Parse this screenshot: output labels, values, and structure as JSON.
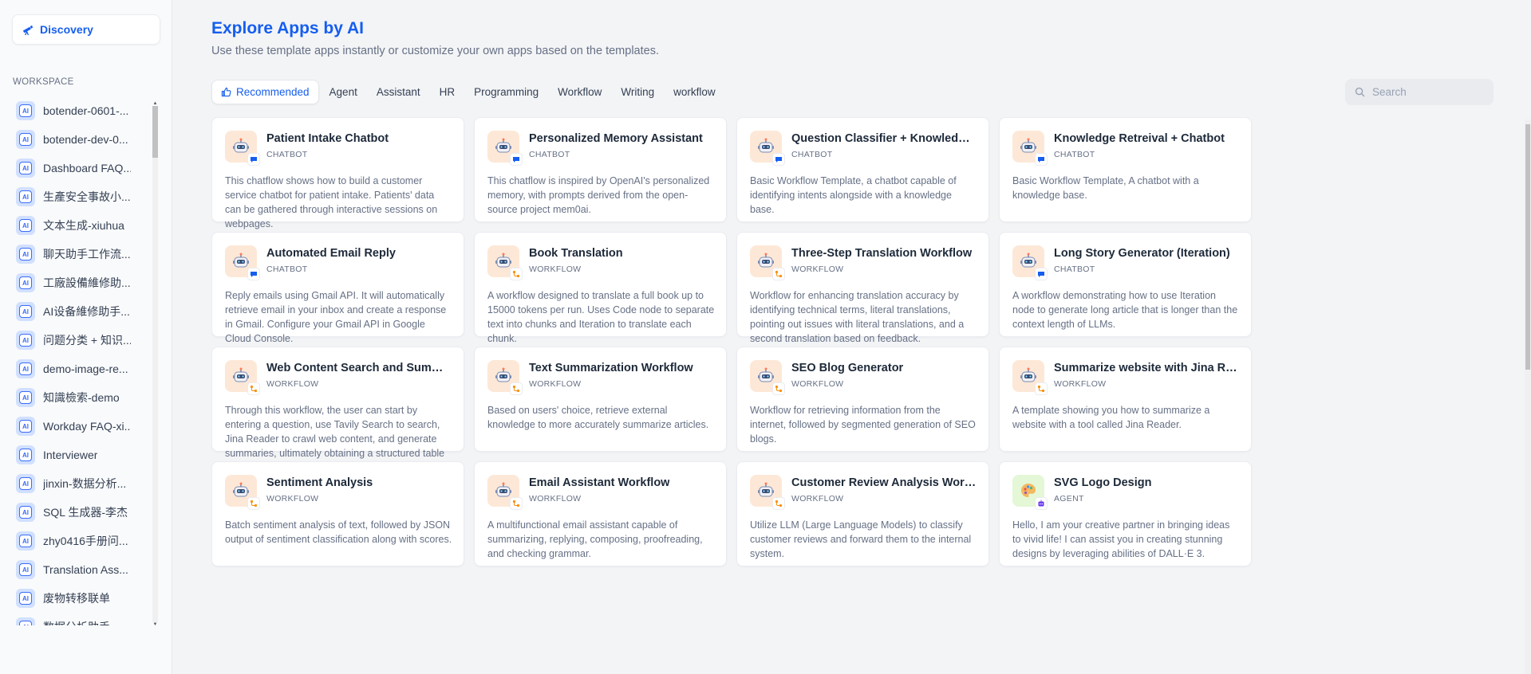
{
  "sidebar": {
    "discovery_label": "Discovery",
    "workspace_title": "WORKSPACE",
    "items": [
      {
        "label": "botender-0601-..."
      },
      {
        "label": "botender-dev-0..."
      },
      {
        "label": "Dashboard FAQ..."
      },
      {
        "label": "生產安全事故小..."
      },
      {
        "label": "文本生成-xiuhua"
      },
      {
        "label": "聊天助手工作流..."
      },
      {
        "label": "工廠設備維修助..."
      },
      {
        "label": "AI设备維修助手..."
      },
      {
        "label": "问题分类 + 知识..."
      },
      {
        "label": "demo-image-re..."
      },
      {
        "label": "知識檢索-demo"
      },
      {
        "label": "Workday FAQ-xi..."
      },
      {
        "label": "Interviewer"
      },
      {
        "label": "jinxin-数据分析..."
      },
      {
        "label": "SQL 生成器-李杰"
      },
      {
        "label": "zhy0416手册问..."
      },
      {
        "label": "Translation Ass..."
      },
      {
        "label": "废物转移联单"
      },
      {
        "label": "数据分析助手"
      }
    ],
    "icon_text": "AI"
  },
  "header": {
    "title": "Explore Apps by AI",
    "subtitle": "Use these template apps instantly or customize your own apps based on the templates."
  },
  "tabs": [
    {
      "label": "Recommended"
    },
    {
      "label": "Agent"
    },
    {
      "label": "Assistant"
    },
    {
      "label": "HR"
    },
    {
      "label": "Programming"
    },
    {
      "label": "Workflow"
    },
    {
      "label": "Writing"
    },
    {
      "label": "workflow"
    }
  ],
  "search": {
    "placeholder": "Search",
    "value": ""
  },
  "colors": {
    "accent": "#155eef",
    "icon_bg": "#fde8d7",
    "agent_icon_bg": "#e4f7d6"
  },
  "cards": [
    {
      "title": "Patient Intake Chatbot",
      "type": "CHATBOT",
      "desc": "This chatflow shows how to build a customer service chatbot for patient intake. Patients' data can be gathered through interactive sessions on webpages."
    },
    {
      "title": "Personalized Memory Assistant",
      "type": "CHATBOT",
      "desc": "This chatflow is inspired by OpenAI's personalized memory, with prompts derived from the open-source project mem0ai."
    },
    {
      "title": "Question Classifier + Knowledge + Chatbot",
      "type": "CHATBOT",
      "desc": "Basic Workflow Template, a chatbot capable of identifying intents alongside with a knowledge base."
    },
    {
      "title": "Knowledge Retreival + Chatbot",
      "type": "CHATBOT",
      "desc": "Basic Workflow Template, A chatbot with a knowledge base."
    },
    {
      "title": "Automated Email Reply",
      "type": "CHATBOT",
      "desc": "Reply emails using Gmail API. It will automatically retrieve email in your inbox and create a response in Gmail. Configure your Gmail API in Google Cloud Console."
    },
    {
      "title": "Book Translation",
      "type": "WORKFLOW",
      "desc": "A workflow designed to translate a full book up to 15000 tokens per run. Uses Code node to separate text into chunks and Iteration to translate each chunk."
    },
    {
      "title": "Three-Step Translation Workflow",
      "type": "WORKFLOW",
      "desc": "Workflow for enhancing translation accuracy by identifying technical terms, literal translations, pointing out issues with literal translations, and a second translation based on feedback."
    },
    {
      "title": "Long Story Generator (Iteration)",
      "type": "CHATBOT",
      "desc": "A workflow demonstrating how to use Iteration node to generate long article that is longer than the context length of LLMs."
    },
    {
      "title": "Web Content Search and Summarization Workflow",
      "type": "WORKFLOW",
      "desc": "Through this workflow, the user can start by entering a question, use Tavily Search to search, Jina Reader to crawl web content, and generate summaries, ultimately obtaining a structured table of results."
    },
    {
      "title": "Text Summarization Workflow",
      "type": "WORKFLOW",
      "desc": "Based on users' choice, retrieve external knowledge to more accurately summarize articles."
    },
    {
      "title": "SEO Blog Generator",
      "type": "WORKFLOW",
      "desc": "Workflow for retrieving information from the internet, followed by segmented generation of SEO blogs."
    },
    {
      "title": "Summarize website with Jina Reader",
      "type": "WORKFLOW",
      "desc": "A template showing you how to summarize a website with a tool called Jina Reader."
    },
    {
      "title": "Sentiment Analysis",
      "type": "WORKFLOW",
      "desc": "Batch sentiment analysis of text, followed by JSON output of sentiment classification along with scores."
    },
    {
      "title": "Email Assistant Workflow",
      "type": "WORKFLOW",
      "desc": "A multifunctional email assistant capable of summarizing, replying, composing, proofreading, and checking grammar."
    },
    {
      "title": "Customer Review Analysis Workflow",
      "type": "WORKFLOW",
      "desc": "Utilize LLM (Large Language Models) to classify customer reviews and forward them to the internal system."
    },
    {
      "title": "SVG Logo Design",
      "type": "AGENT",
      "desc": "Hello, I am your creative partner in bringing ideas to vivid life! I can assist you in creating stunning designs by leveraging abilities of DALL·E 3."
    }
  ]
}
